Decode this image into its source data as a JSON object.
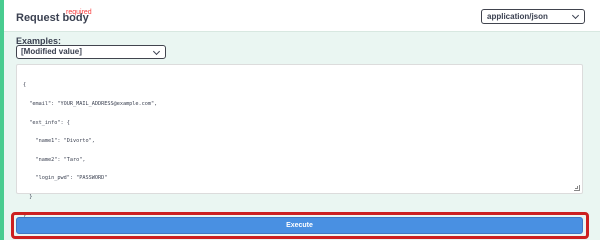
{
  "request_body": {
    "label": "Request body",
    "required": "required",
    "content_type": "application/json"
  },
  "examples": {
    "label": "Examples:",
    "selected": "[Modified value]"
  },
  "editor": {
    "lines": [
      "{",
      "  \"email\": \"YOUR_MAIL_ADDRESS@example.com\",",
      "  \"ext_info\": {",
      "    \"name1\": \"Divorto\",",
      "    \"name2\": \"Taro\",",
      "    \"login_pwd\": \"PASSWORD\"",
      "  }",
      "}"
    ]
  },
  "execute": {
    "label": "Execute"
  },
  "colors": {
    "accent": "#4990e2",
    "highlight": "#cc2020",
    "background": "#eaf6f2"
  }
}
